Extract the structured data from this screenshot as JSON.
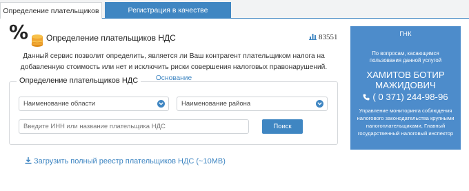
{
  "tabs": [
    {
      "label": "Определение плательщиков НДС",
      "active": true
    },
    {
      "label": "Регистрация в качестве плательщика НДС",
      "active": false
    }
  ],
  "header": {
    "title": "Определение плательщиков НДС",
    "views_count": "83551",
    "views_icon": "bar-chart-icon",
    "logo_icon": "percent-coins-icon"
  },
  "description": {
    "text": "Данный сервис позволит определить, является ли Ваш контрагент плательщиком налога на добавленную стоимость или нет и исключить риски совершения налоговых правонарушений.",
    "link": "Основание"
  },
  "form": {
    "legend": "Определение плательщиков НДС",
    "region_select": "Наименование области",
    "district_select": "Наименование района",
    "search_placeholder": "Введите ИНН или название плательщика НДС",
    "search_button": "Поиск"
  },
  "download": {
    "label": "Загрузить полный реестр плательщиков НДС (~10MB)",
    "icon": "download-icon"
  },
  "contact": {
    "heading": "ГНК",
    "note": "По вопросам, касающимся пользования данной услугой",
    "name": "ХАМИТОВ БОТИР МАЖИДОВИЧ",
    "phone": "( 0 371) 244-98-96",
    "phone_icon": "phone-icon",
    "department": "Управление мониторинга соблюдения налогового законодательства крупными налогоплательщиками, Главный государственный налоговый инспектор"
  },
  "colors": {
    "accent": "#3f86c2",
    "contact_bg": "#4d8ccb",
    "coins": "#f0a531"
  }
}
